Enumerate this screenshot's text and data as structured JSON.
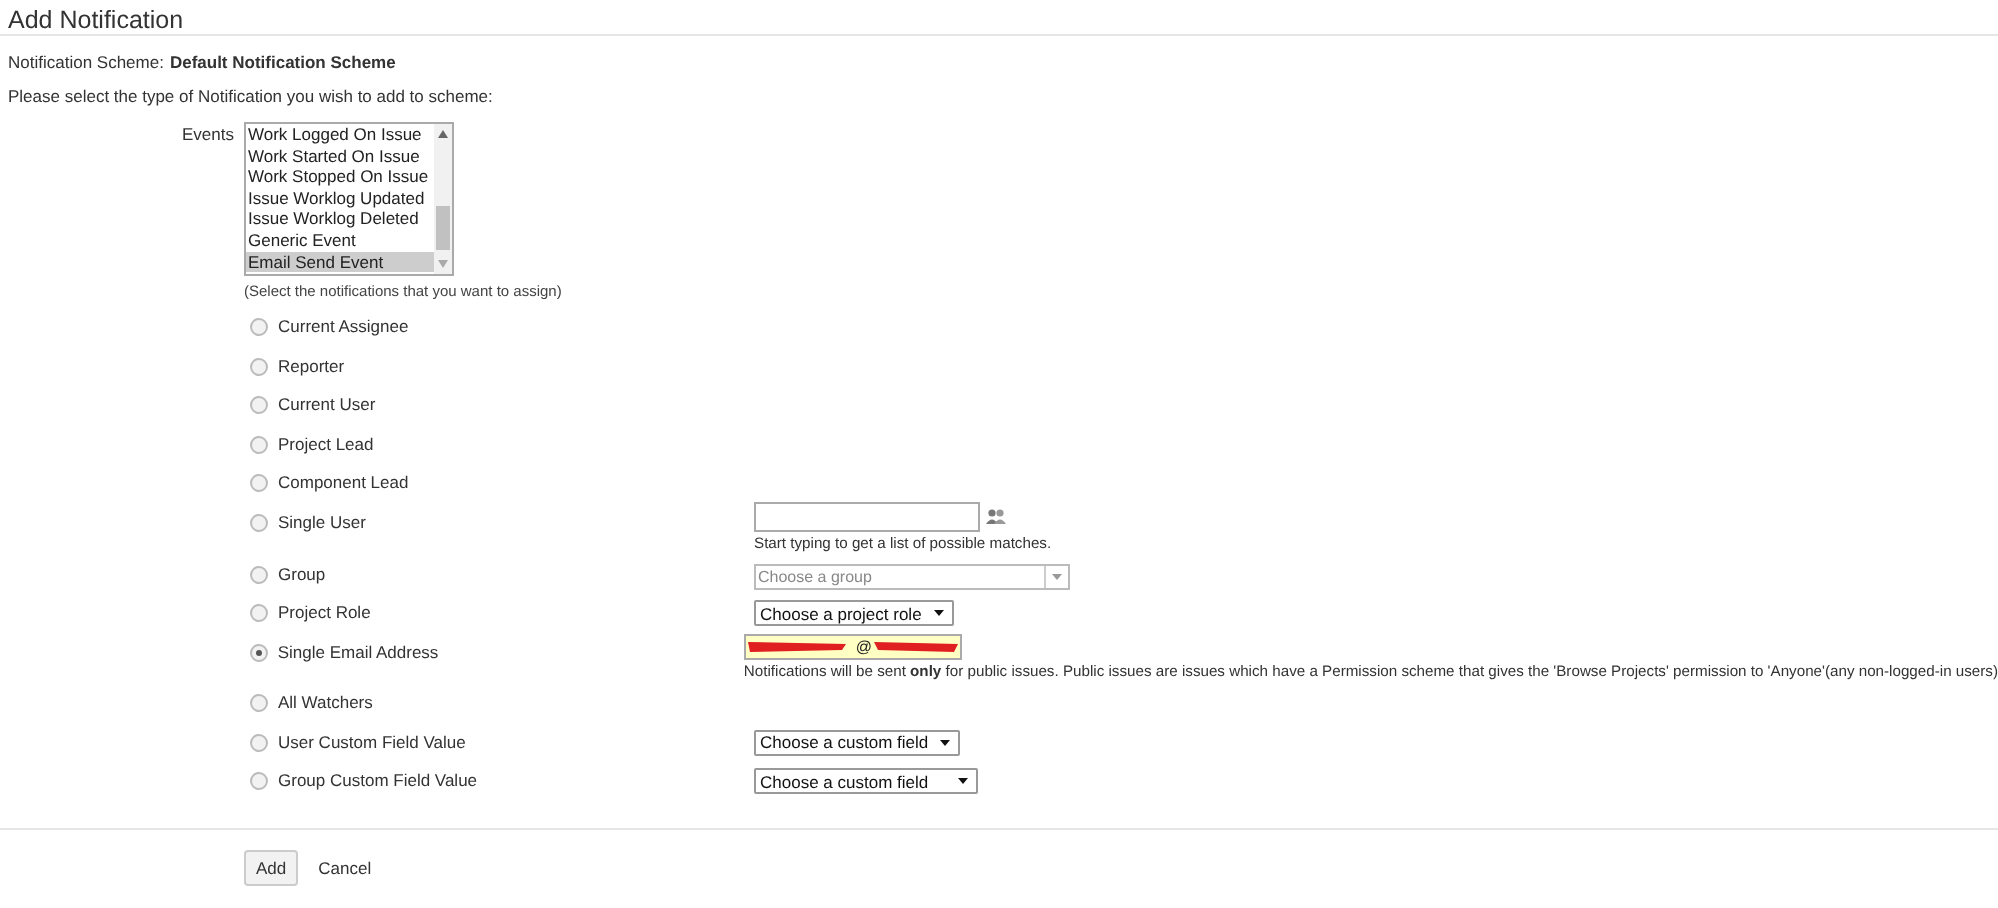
{
  "page_title": "Add Notification",
  "scheme": {
    "label": "Notification Scheme:",
    "value": "Default Notification Scheme"
  },
  "instruction": "Please select the type of Notification you wish to add to scheme:",
  "events": {
    "label": "Events",
    "items": [
      {
        "label": "Work Logged On Issue",
        "selected": false
      },
      {
        "label": "Work Started On Issue",
        "selected": false
      },
      {
        "label": "Work Stopped On Issue",
        "selected": false
      },
      {
        "label": "Issue Worklog Updated",
        "selected": false
      },
      {
        "label": "Issue Worklog Deleted",
        "selected": false
      },
      {
        "label": "Generic Event",
        "selected": false
      },
      {
        "label": "Email Send Event",
        "selected": true
      }
    ],
    "hint": "(Select the notifications that you want to assign)"
  },
  "options": [
    {
      "label": "Current Assignee",
      "selected": false
    },
    {
      "label": "Reporter",
      "selected": false
    },
    {
      "label": "Current User",
      "selected": false
    },
    {
      "label": "Project Lead",
      "selected": false
    },
    {
      "label": "Component Lead",
      "selected": false
    },
    {
      "label": "Single User",
      "selected": false,
      "control": {
        "kind": "user"
      },
      "hint": "Start typing to get a list of possible matches."
    },
    {
      "label": "Group",
      "selected": false,
      "control": {
        "kind": "combo",
        "placeholder": "Choose a group"
      }
    },
    {
      "label": "Project Role",
      "selected": false,
      "control": {
        "kind": "select",
        "value": "Choose a project role"
      }
    },
    {
      "label": "Single Email Address",
      "selected": true,
      "control": {
        "kind": "redacted",
        "value": "@"
      },
      "hint": "Notifications will be sent **only** for public issues. Public issues are issues which have a Permission scheme that gives the 'Browse Projects' permission to 'Anyone'(any non-logged-in users)"
    },
    {
      "label": "All Watchers",
      "selected": false
    },
    {
      "label": "User Custom Field Value",
      "selected": false,
      "control": {
        "kind": "select",
        "value": "Choose a custom field"
      }
    },
    {
      "label": "Group Custom Field Value",
      "selected": false,
      "control": {
        "kind": "select",
        "value": "Choose a custom field"
      }
    }
  ],
  "buttons": {
    "submit": "Add",
    "cancel": "Cancel"
  }
}
